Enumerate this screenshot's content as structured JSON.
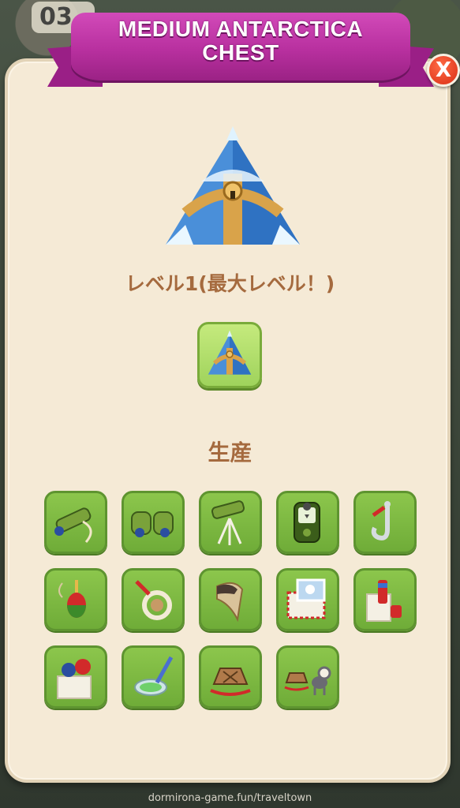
{
  "header": {
    "title_line1": "MEDIUM ANTARCTICA",
    "title_line2": "CHEST",
    "close_label": "X",
    "top_counter": "03"
  },
  "chest": {
    "level_text": "レベル1(最大レベル！)"
  },
  "production": {
    "title": "生産",
    "items": [
      {
        "icon": "spyglass-icon"
      },
      {
        "icon": "binoculars-icon"
      },
      {
        "icon": "telescope-icon"
      },
      {
        "icon": "gps-device-icon"
      },
      {
        "icon": "fishing-hook-icon"
      },
      {
        "icon": "fishing-float-icon"
      },
      {
        "icon": "life-ring-icon"
      },
      {
        "icon": "tooth-fang-icon"
      },
      {
        "icon": "postcard-envelope-icon"
      },
      {
        "icon": "thermos-box-icon"
      },
      {
        "icon": "gift-box-icon"
      },
      {
        "icon": "petri-dish-icon"
      },
      {
        "icon": "sled-icon"
      },
      {
        "icon": "dog-sled-icon"
      }
    ]
  },
  "footer": {
    "watermark": "dormirona-game.fun/traveltown"
  },
  "colors": {
    "panel": "#f5ead6",
    "ribbon": "#b8309f",
    "tile_green": "#7cbb42",
    "text_brown": "#a56a3e",
    "close_red": "#e03a1c"
  }
}
